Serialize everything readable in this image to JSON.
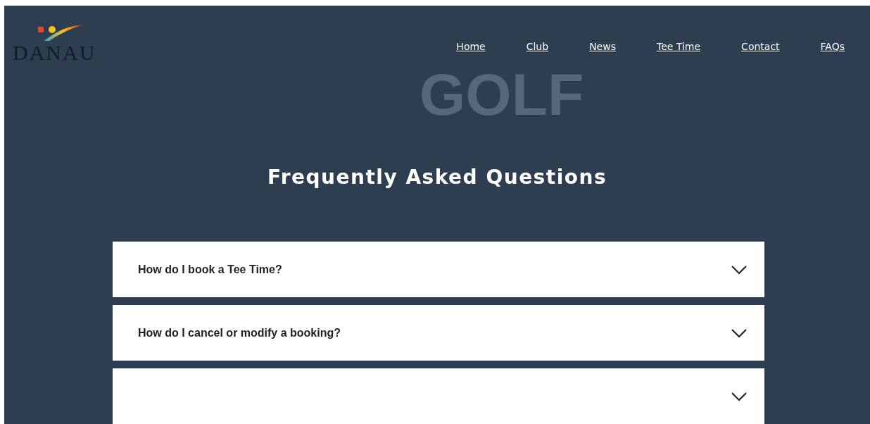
{
  "header": {
    "logo_text": "DANAU",
    "backdrop_word": "GOLF",
    "nav": [
      {
        "label": "Home"
      },
      {
        "label": "Club"
      },
      {
        "label": "News"
      },
      {
        "label": "Tee Time"
      },
      {
        "label": "Contact"
      },
      {
        "label": "FAQs"
      }
    ]
  },
  "title": "Frequently Asked Questions",
  "faqs": [
    {
      "question": "How do I book a Tee Time?",
      "expanded": false
    },
    {
      "question": "How do I cancel or modify a booking?",
      "expanded": false
    },
    {
      "expanded": false
    }
  ]
}
